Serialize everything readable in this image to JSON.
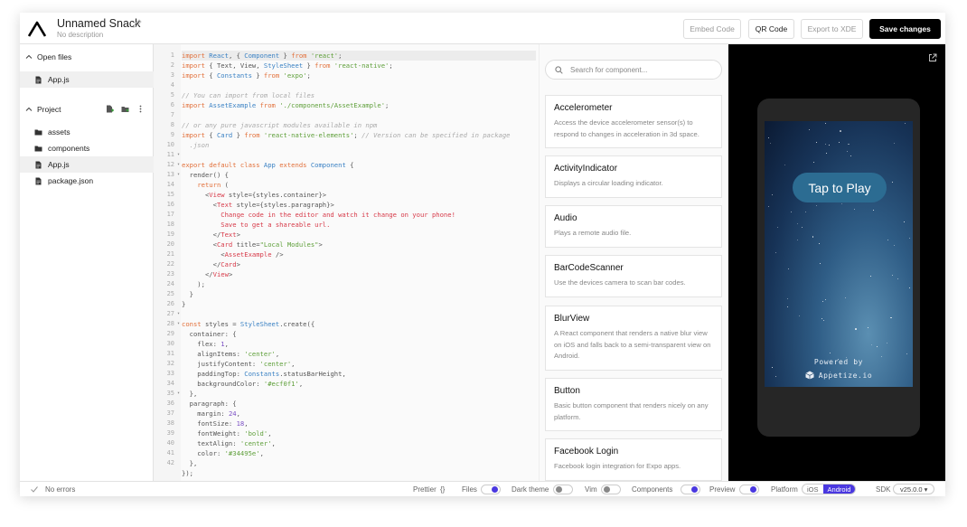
{
  "header": {
    "title": "Unnamed Snack",
    "description": "No description",
    "embed_label": "Embed Code",
    "qr_label": "QR Code",
    "export_label": "Export to XDE",
    "save_label": "Save changes"
  },
  "sidebar": {
    "open_files_label": "Open files",
    "open_files": [
      "App.js"
    ],
    "project_label": "Project",
    "files": [
      {
        "name": "assets",
        "type": "folder"
      },
      {
        "name": "components",
        "type": "folder"
      },
      {
        "name": "App.js",
        "type": "file"
      },
      {
        "name": "package.json",
        "type": "file"
      }
    ]
  },
  "editor": {
    "line_numbers": [
      "1",
      "2",
      "3",
      "4",
      "5",
      "6",
      "7",
      "8",
      "9",
      "10",
      "11",
      "12",
      "13",
      "14",
      "15",
      "16",
      "17",
      "18",
      "19",
      "20",
      "21",
      "22",
      "23",
      "24",
      "25",
      "26",
      "27",
      "28",
      "29",
      "30",
      "31",
      "32",
      "33",
      "34",
      "35",
      "36",
      "37",
      "38",
      "39",
      "40",
      "41",
      "42"
    ],
    "lines": [
      "import React, { Component } from 'react';",
      "import { Text, View, StyleSheet } from 'react-native';",
      "import { Constants } from 'expo';",
      "",
      "// You can import from local files",
      "import AssetExample from './components/AssetExample';",
      "",
      "// or any pure javascript modules available in npm",
      "import { Card } from 'react-native-elements'; // Version can be specified in package",
      "  .json",
      "",
      "export default class App extends Component {",
      "  render() {",
      "    return (",
      "      <View style={styles.container}>",
      "        <Text style={styles.paragraph}>",
      "          Change code in the editor and watch it change on your phone!",
      "          Save to get a shareable url.",
      "        </Text>",
      "        <Card title=\"Local Modules\">",
      "          <AssetExample />",
      "        </Card>",
      "      </View>",
      "    );",
      "  }",
      "}",
      "",
      "const styles = StyleSheet.create({",
      "  container: {",
      "    flex: 1,",
      "    alignItems: 'center',",
      "    justifyContent: 'center',",
      "    paddingTop: Constants.statusBarHeight,",
      "    backgroundColor: '#ecf0f1',",
      "  },",
      "  paragraph: {",
      "    margin: 24,",
      "    fontSize: 18,",
      "    fontWeight: 'bold',",
      "    textAlign: 'center',",
      "    color: '#34495e',",
      "  },",
      "});"
    ]
  },
  "components": {
    "search_placeholder": "Search for component...",
    "items": [
      {
        "name": "Accelerometer",
        "desc": "Access the device accelerometer sensor(s) to respond to changes in acceleration in 3d space."
      },
      {
        "name": "ActivityIndicator",
        "desc": "Displays a circular loading indicator."
      },
      {
        "name": "Audio",
        "desc": "Plays a remote audio file."
      },
      {
        "name": "BarCodeScanner",
        "desc": "Use the devices camera to scan bar codes."
      },
      {
        "name": "BlurView",
        "desc": "A React component that renders a native blur view on iOS and falls back to a semi-transparent view on Android."
      },
      {
        "name": "Button",
        "desc": "Basic button component that renders nicely on any platform."
      },
      {
        "name": "Facebook Login",
        "desc": "Facebook login integration for Expo apps."
      }
    ]
  },
  "preview": {
    "tap_label": "Tap to Play",
    "powered_label": "Powered by",
    "appetize_label": "Appetize.io"
  },
  "statusbar": {
    "errors": "No errors",
    "prettier": "Prettier",
    "prettier_braces": "{}",
    "files": "Files",
    "dark_theme": "Dark theme",
    "vim": "Vim",
    "components": "Components",
    "preview": "Preview",
    "platform": "Platform",
    "ios": "iOS",
    "android": "Android",
    "sdk": "SDK",
    "sdk_version": "v25.0.0 ▾"
  },
  "colors": {
    "accent": "#4a38e0",
    "save_bg": "#000000"
  }
}
